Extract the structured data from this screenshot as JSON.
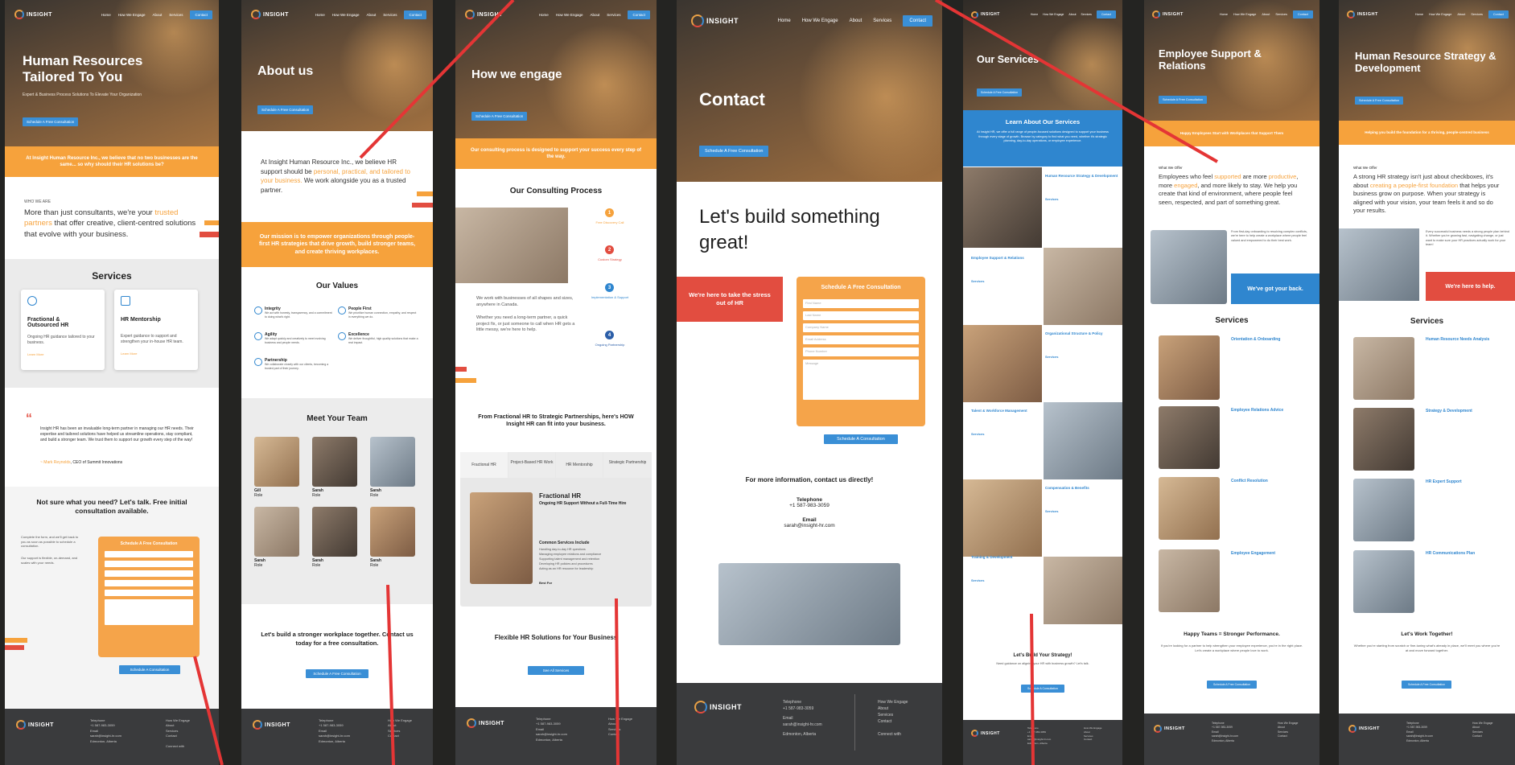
{
  "brand": {
    "logo_text": "INSIGHT"
  },
  "nav": {
    "home": "Home",
    "engage": "How We Engage",
    "about": "About",
    "services": "Services",
    "contact": "Contact"
  },
  "home": {
    "hero_title": "Human Resources Tailored To You",
    "hero_sub": "Expert & Business Process Solutions To Elevate Your Organization",
    "cta": "Schedule A Free Consultation",
    "band": "At Insight Human Resource Inc., we believe that no two businesses are the same... so why should their HR solutions be?",
    "who_label": "WHO WE ARE",
    "who_text_a": "More than just consultants, we're your ",
    "who_text_hl": "trusted partners",
    "who_text_b": " that offer creative, client-centred solutions that evolve with your business.",
    "services_title": "Services",
    "svc1_title": "Fractional & Outsourced HR",
    "svc1_text": "Ongoing HR guidance tailored to your business.",
    "svc2_title": "HR Mentorship",
    "svc2_text": "Expert guidance to support and strengthen your in-house HR team.",
    "learn_more": "Learn More",
    "quote": "Insight HR has been an invaluable long-term partner in managing our HR needs. Their expertise and tailored solutions have helped us streamline operations, stay compliant, and build a stronger team. We trust them to support our growth every step of the way!",
    "quote_author": "~ Mark Reynolds",
    "quote_role": ", CEO of Summit Innovations",
    "ns_title": "Not sure what you need? Let's talk. Free initial consultation available.",
    "ns_text1": "Complete the form, and we'll get back to you as soon as possible to schedule a consultation.",
    "ns_text2": "Our support is flexible, on-demand, and scales with your needs.",
    "form_title": "Schedule A Free Consultation",
    "submit": "Schedule A Consultation"
  },
  "about": {
    "hero_title": "About us",
    "cta": "Schedule A Free Consultation",
    "intro_a": "At Insight Human Resource Inc., we believe HR support should be ",
    "intro_hl": "personal, practical, and tailored to your business.",
    "intro_b": " We work alongside you as a trusted partner.",
    "mission": "Our mission is to empower organizations through people-first HR strategies that drive growth, build stronger teams, and create thriving workplaces.",
    "values_title": "Our Values",
    "values": [
      {
        "name": "Integrity",
        "text": "We act with honesty, transparency, and a commitment to doing what's right."
      },
      {
        "name": "People First",
        "text": "We prioritize human connection, empathy, and respect in everything we do."
      },
      {
        "name": "Agility",
        "text": "We adapt quickly and creatively to meet evolving business and people needs."
      },
      {
        "name": "Excellence",
        "text": "We deliver thoughtful, high quality solutions that make a real impact."
      },
      {
        "name": "Partnership",
        "text": "We collaborate closely with our clients, becoming a trusted part of their journey."
      }
    ],
    "team_title": "Meet Your Team",
    "team": [
      {
        "name": "Gill",
        "role": "Role"
      },
      {
        "name": "Sarah",
        "role": "Role"
      },
      {
        "name": "Sarah",
        "role": "Role"
      },
      {
        "name": "Sarah",
        "role": "Role"
      },
      {
        "name": "Sarah",
        "role": "Role"
      },
      {
        "name": "Sarah",
        "role": "Role"
      }
    ],
    "closing": "Let's build a stronger workplace together. Contact us today for a free consultation.",
    "closing_btn": "Schedule A Free Consultation"
  },
  "engage": {
    "hero_title": "How we engage",
    "cta": "Schedule A Free Consultation",
    "band": "Our consulting process is designed to support your success every step of the way.",
    "process_title": "Our Consulting Process",
    "steps": [
      {
        "num": "1",
        "label": "Free Discovery Call"
      },
      {
        "num": "2",
        "label": "Custom Strategy"
      },
      {
        "num": "3",
        "label": "Implementation & Support"
      },
      {
        "num": "4",
        "label": "Ongoing Partnership"
      }
    ],
    "text1": "We work with businesses of all shapes and sizes, anywhere in Canada.",
    "text2": "Whether you need a long-term partner, a quick project fix, or just someone to call when HR gets a little messy, we're here to help.",
    "fit_title": "From Fractional HR to Strategic Partnerships, here's HOW Insight HR can fit into your business.",
    "tabs": [
      "Fractional HR",
      "Project-Based HR Work",
      "HR Mentorship",
      "Strategic Partnership"
    ],
    "panel_title": "Fractional HR",
    "panel_sub": "Ongoing HR Support Without a Full-Time Hire",
    "panel_services_label": "Common Services Include",
    "panel_items": [
      "Handling day-to-day HR questions",
      "Managing employee relations and compliance",
      "Supporting talent management and retention",
      "Developing HR policies and procedures",
      "Acting as an HR resource for leadership"
    ],
    "best_for": "Best For",
    "flex_title": "Flexible HR Solutions for Your Business",
    "flex_btn": "See All Services"
  },
  "contact": {
    "hero_title": "Contact",
    "cta": "Schedule A Free Consultation",
    "big_title": "Let's build something great!",
    "red_box": "We're here to take the stress out of HR",
    "form_title": "Schedule A Free Consultation",
    "fields": [
      "First Name",
      "Last Name",
      "Company Name",
      "Email Address",
      "Phone Number",
      "Message"
    ],
    "submit": "Schedule A Consultation",
    "more_info": "For more information, contact us directly!",
    "tel_label": "Telephone",
    "tel": "+1 587-983-3059",
    "email_label": "Email",
    "email": "sarah@insight-hr.com"
  },
  "services_page": {
    "hero_title": "Our Services",
    "cta": "Schedule A Free Consultation",
    "learn_title": "Learn About Our Services",
    "learn_text": "At Insight HR, we offer a full range of people-focused solutions designed to support your business through every stage of growth. Browse by category to find what you need, whether it's strategic planning, day-to-day operations, or employee experience.",
    "cats": [
      {
        "title": "Human Resource Strategy & Development",
        "label": "Services"
      },
      {
        "title": "Employee Support & Relations",
        "label": "Services"
      },
      {
        "title": "Organizational Structure & Policy",
        "label": "Services"
      },
      {
        "title": "Talent & Workforce Management",
        "label": "Services"
      },
      {
        "title": "Compensation & Benefits",
        "label": "Services"
      },
      {
        "title": "Training & Development",
        "label": "Services"
      }
    ],
    "cta_title": "Let's Build Your Strategy!",
    "cta_text": "Need guidance on aligning your HR with business growth? Let's talk.",
    "cta_btn": "Schedule A Consultation"
  },
  "support_page": {
    "hero_title": "Employee Support & Relations",
    "cta": "Schedule A Free Consultation",
    "band": "Happy Employees Start with Workplaces that Support Them",
    "offer_label": "What We Offer",
    "offer_a": "Employees who feel ",
    "offer_hl1": "supported",
    "offer_b": " are more ",
    "offer_hl2": "productive",
    "offer_c": ", more ",
    "offer_hl3": "engaged",
    "offer_d": ", and more likely to stay. We help you create that kind of environment, where people feel seen, respected, and part of something great.",
    "side_text": "From first-day onboarding to resolving complex conflicts, we're here to help create a workplace where people feel valued and empowered to do their best work.",
    "blue_box": "We've got your back.",
    "services_title": "Services",
    "items": [
      "Orientation & Onboarding",
      "Employee Relations Advice",
      "Conflict Resolution",
      "Employee Engagement"
    ],
    "happy_title": "Happy Teams = Stronger Performance.",
    "happy_text": "If you're looking for a partner to help strengthen your employee experience, you're in the right place. Let's create a workplace where people love to work.",
    "btn": "Schedule A Free Consultation"
  },
  "strategy_page": {
    "hero_title": "Human Resource Strategy & Development",
    "cta": "Schedule A Free Consultation",
    "band": "Helping you build the foundation for a thriving, people-centred business",
    "offer_label": "What We Offer",
    "offer_a": "A strong HR strategy isn't just about checkboxes, it's about ",
    "offer_hl": "creating a people-first foundation",
    "offer_b": " that helps your business grow on purpose. When your strategy is aligned with your vision, your team feels it and so do your results.",
    "side_text": "Every successful business needs a strong people plan behind it. Whether you're growing fast, navigating change, or just want to make sure your HR practices actually work for your team!",
    "red_box": "We're here to help.",
    "services_title": "Services",
    "items": [
      "Human Resource Needs Analysis",
      "Strategy & Development",
      "HR Expert Support",
      "HR Communications Plan"
    ],
    "work_title": "Let's Work Together!",
    "work_text": "Whether you're starting from scratch or fine-tuning what's already in place, we'll meet you where you're at and move forward together.",
    "btn": "Schedule A Free Consultation"
  },
  "footer": {
    "tel_label": "Telephone",
    "tel": "+1 587-983-3059",
    "email_label": "Email",
    "email": "sarah@insight-hr.com",
    "location": "Edmonton, Alberta",
    "link1": "How We Engage",
    "link2": "About",
    "link3": "Services",
    "link4": "Contact",
    "connect": "Connect with"
  },
  "colors": {
    "orange": "#f6a23c",
    "blue": "#3a8fd6",
    "red": "#e24d40",
    "footer": "#3a3b3d",
    "annotation_red": "#e43535"
  }
}
